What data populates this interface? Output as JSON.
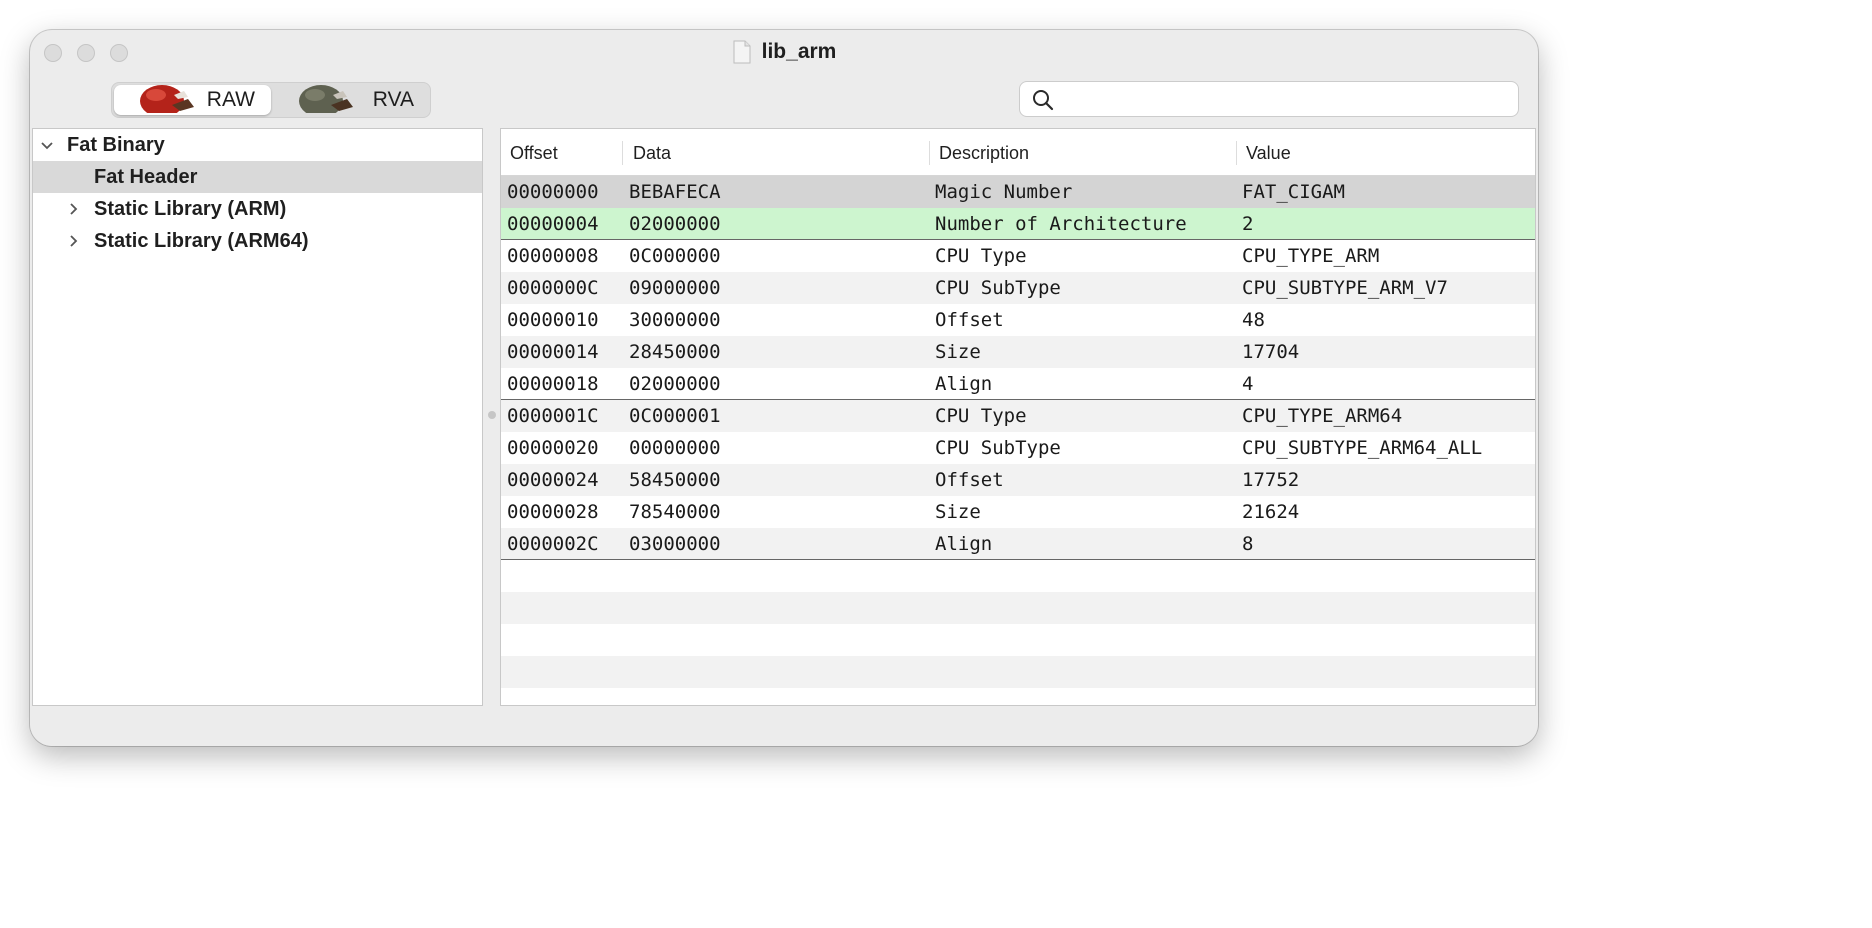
{
  "window": {
    "title": "lib_arm"
  },
  "mode_toggle": {
    "options": [
      "RAW",
      "RVA"
    ],
    "selected": "RAW"
  },
  "search": {
    "placeholder": "",
    "value": ""
  },
  "tree": {
    "items": [
      {
        "label": "Fat Binary",
        "expanded": true
      },
      {
        "label": "Fat Header",
        "selected": true
      },
      {
        "label": "Static Library (ARM)",
        "expanded": false
      },
      {
        "label": "Static Library (ARM64)",
        "expanded": false
      }
    ]
  },
  "table": {
    "columns": [
      "Offset",
      "Data",
      "Description",
      "Value"
    ],
    "rows": [
      {
        "offset": "00000000",
        "data": "BEBAFECA",
        "description": "Magic Number",
        "value": "FAT_CIGAM"
      },
      {
        "offset": "00000004",
        "data": "02000000",
        "description": "Number of Architecture",
        "value": "2"
      },
      {
        "offset": "00000008",
        "data": "0C000000",
        "description": "CPU Type",
        "value": "CPU_TYPE_ARM"
      },
      {
        "offset": "0000000C",
        "data": "09000000",
        "description": "CPU SubType",
        "value": "CPU_SUBTYPE_ARM_V7"
      },
      {
        "offset": "00000010",
        "data": "30000000",
        "description": "Offset",
        "value": "48"
      },
      {
        "offset": "00000014",
        "data": "28450000",
        "description": "Size",
        "value": "17704"
      },
      {
        "offset": "00000018",
        "data": "02000000",
        "description": "Align",
        "value": "4"
      },
      {
        "offset": "0000001C",
        "data": "0C000001",
        "description": "CPU Type",
        "value": "CPU_TYPE_ARM64"
      },
      {
        "offset": "00000020",
        "data": "00000000",
        "description": "CPU SubType",
        "value": "CPU_SUBTYPE_ARM64_ALL"
      },
      {
        "offset": "00000024",
        "data": "58450000",
        "description": "Offset",
        "value": "17752"
      },
      {
        "offset": "00000028",
        "data": "78540000",
        "description": "Size",
        "value": "21624"
      },
      {
        "offset": "0000002C",
        "data": "03000000",
        "description": "Align",
        "value": "8"
      }
    ]
  },
  "colors": {
    "selected_row": "#d4d4d4",
    "highlight_row": "#cdf5cf",
    "alt_row": "#f2f2f2"
  }
}
